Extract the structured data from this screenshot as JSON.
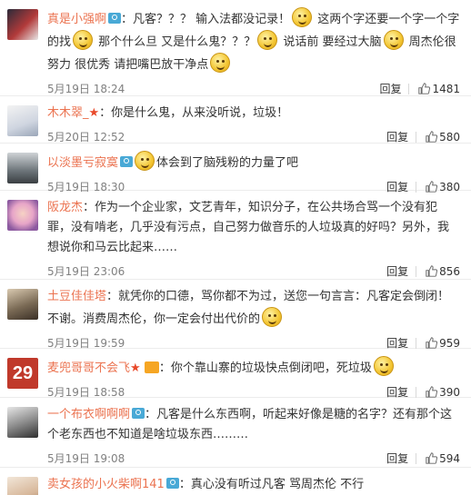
{
  "comments": [
    {
      "user": "真是小强啊",
      "badge": true,
      "pre": "：凡客？？？  输入法都没记录！",
      "mid1": "  这两个字还要一个字一个字的找",
      "mid2": "  那个什么旦  又是什么鬼？？？",
      "mid3": "  说话前  要经过大脑",
      "mid4": "  周杰伦很努力  很优秀   请把嘴巴放干净点",
      "time": "5月19日 18:24",
      "reply": "回复",
      "likes": "1481"
    },
    {
      "user": "木木翠_",
      "star": "★",
      "pre": "：你是什么鬼，从来没听说，垃圾！",
      "time": "5月20日 12:52",
      "reply": "回复",
      "likes": "580"
    },
    {
      "user": "以淡墨亏寂寞",
      "badge": true,
      "pre": "体会到了脑残粉的力量了吧",
      "time": "5月19日 18:30",
      "reply": "回复",
      "likes": "380"
    },
    {
      "user": "阪龙杰",
      "pre": "：作为一个企业家，文艺青年，知识分子，在公共场合骂一个没有犯罪，没有啃老，几乎没有污点，自己努力做音乐的人垃圾真的好吗？另外，我想说你和马云比起来……",
      "time": "5月19日 23:06",
      "reply": "回复",
      "likes": "856"
    },
    {
      "user": "土豆佳佳塔",
      "pre": "：就凭你的口德，骂你都不为过，送您一句言言：凡客定会倒闭！不谢。消费周杰伦，你一定会付出代价的",
      "time": "5月19日 19:59",
      "reply": "回复",
      "likes": "959"
    },
    {
      "user": "麦兜哥哥不会飞",
      "star": "★",
      "vip": true,
      "pre": "：你个靠山寨的垃圾快点倒闭吧，死垃圾",
      "time": "5月19日 18:58",
      "reply": "回复",
      "likes": "390"
    },
    {
      "user": "一个布衣啊啊啊",
      "badge": true,
      "pre": "：凡客是什么东西啊，听起来好像是糖的名字？还有那个这个老东西也不知道是啥垃圾东西………",
      "time": "5月19日 19:08",
      "reply": "回复",
      "likes": "594"
    },
    {
      "user": "卖女孩的小火柴啊141",
      "badge": true,
      "pre": "：真心没有听过凡客    骂周杰伦  不行"
    }
  ]
}
